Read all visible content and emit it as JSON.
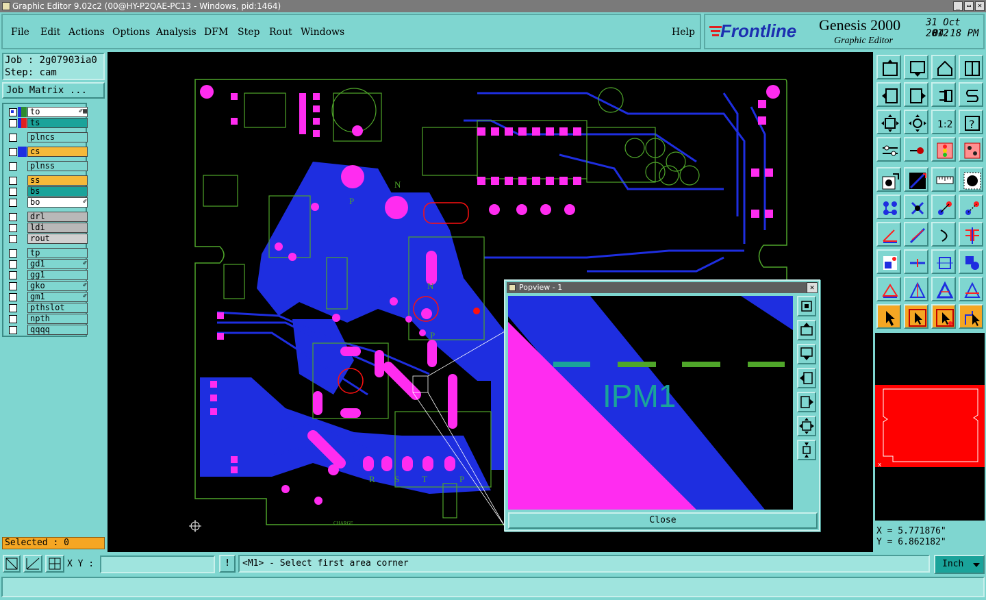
{
  "window": {
    "title": "Graphic Editor 9.02c2 (00@HY-P2QAE-PC13 - Windows, pid:1464)",
    "minimize": "_",
    "maximize": "▭",
    "close": "✕"
  },
  "menu": {
    "file": "File",
    "edit": "Edit",
    "actions": "Actions",
    "options": "Options",
    "analysis": "Analysis",
    "dfm": "DFM",
    "step": "Step",
    "rout": "Rout",
    "windows": "Windows",
    "help": "Help"
  },
  "brand": {
    "logo": "Frontline",
    "product": "Genesis 2000",
    "subtitle": "Graphic Editor",
    "date": "31 Oct 2012",
    "time": "04:18 PM"
  },
  "job": {
    "job_label": "Job : 2g07903ia0",
    "step_label": "Step: cam",
    "matrix_button": "Job Matrix ..."
  },
  "layers": [
    {
      "name": "to",
      "swatch": "#2e8b2e",
      "bg": "#ffffff",
      "icon": "✐▦"
    },
    {
      "name": "ts",
      "swatch": "#e02020",
      "bg": "#1aa39a",
      "icon": ""
    },
    {
      "name": "plncs",
      "swatch": "",
      "bg": "#7fd6d0",
      "icon": ""
    },
    {
      "name": "cs",
      "swatch": "#1e2ee0",
      "bg": "#f5b93a",
      "icon": ""
    },
    {
      "name": "plnss",
      "swatch": "",
      "bg": "#7fd6d0",
      "icon": ""
    },
    {
      "name": "ss",
      "swatch": "",
      "bg": "#f5b93a",
      "icon": ""
    },
    {
      "name": "bs",
      "swatch": "",
      "bg": "#1aa39a",
      "icon": ""
    },
    {
      "name": "bo",
      "swatch": "",
      "bg": "#ffffff",
      "icon": "✐"
    },
    {
      "name": "drl",
      "swatch": "",
      "bg": "#b8b8b8",
      "icon": ""
    },
    {
      "name": "ldi",
      "swatch": "",
      "bg": "#b8b8b8",
      "icon": ""
    },
    {
      "name": "rout",
      "swatch": "",
      "bg": "#d0d0d0",
      "icon": ""
    },
    {
      "name": "tp",
      "swatch": "",
      "bg": "#7fd6d0",
      "icon": ""
    },
    {
      "name": "gd1",
      "swatch": "",
      "bg": "#7fd6d0",
      "icon": "✐"
    },
    {
      "name": "gg1",
      "swatch": "",
      "bg": "#7fd6d0",
      "icon": ""
    },
    {
      "name": "gko",
      "swatch": "",
      "bg": "#7fd6d0",
      "icon": "✐"
    },
    {
      "name": "gm1",
      "swatch": "",
      "bg": "#7fd6d0",
      "icon": "✐"
    },
    {
      "name": "pthslot",
      "swatch": "",
      "bg": "#7fd6d0",
      "icon": ""
    },
    {
      "name": "npth",
      "swatch": "",
      "bg": "#7fd6d0",
      "icon": ""
    },
    {
      "name": "qqqq",
      "swatch": "",
      "bg": "#7fd6d0",
      "icon": ""
    }
  ],
  "selected": "Selected : 0",
  "board_labels": {
    "p1": "P",
    "n1": "N",
    "n2": "N",
    "p2": "P",
    "r": "R",
    "s": "S",
    "t": "T",
    "p3": "P",
    "charge": "CHARGE"
  },
  "popview": {
    "title": "Popview - 1",
    "close_x": "✕",
    "label": "IPM1",
    "close_button": "Close"
  },
  "coords": {
    "x": "X = 5.771876\"",
    "y": "Y = 6.862182\""
  },
  "statusbar": {
    "xy_label": "X Y :",
    "xy_value": "",
    "hint_icon": "!",
    "prompt": "<M1> - Select first area corner",
    "units": "Inch"
  },
  "colors": {
    "background": "#7fd6d0",
    "copper_top": "#1e2ee0",
    "pads": "#ff2cf0",
    "silkscreen": "#4fa62a",
    "preview": "#ff0000"
  }
}
